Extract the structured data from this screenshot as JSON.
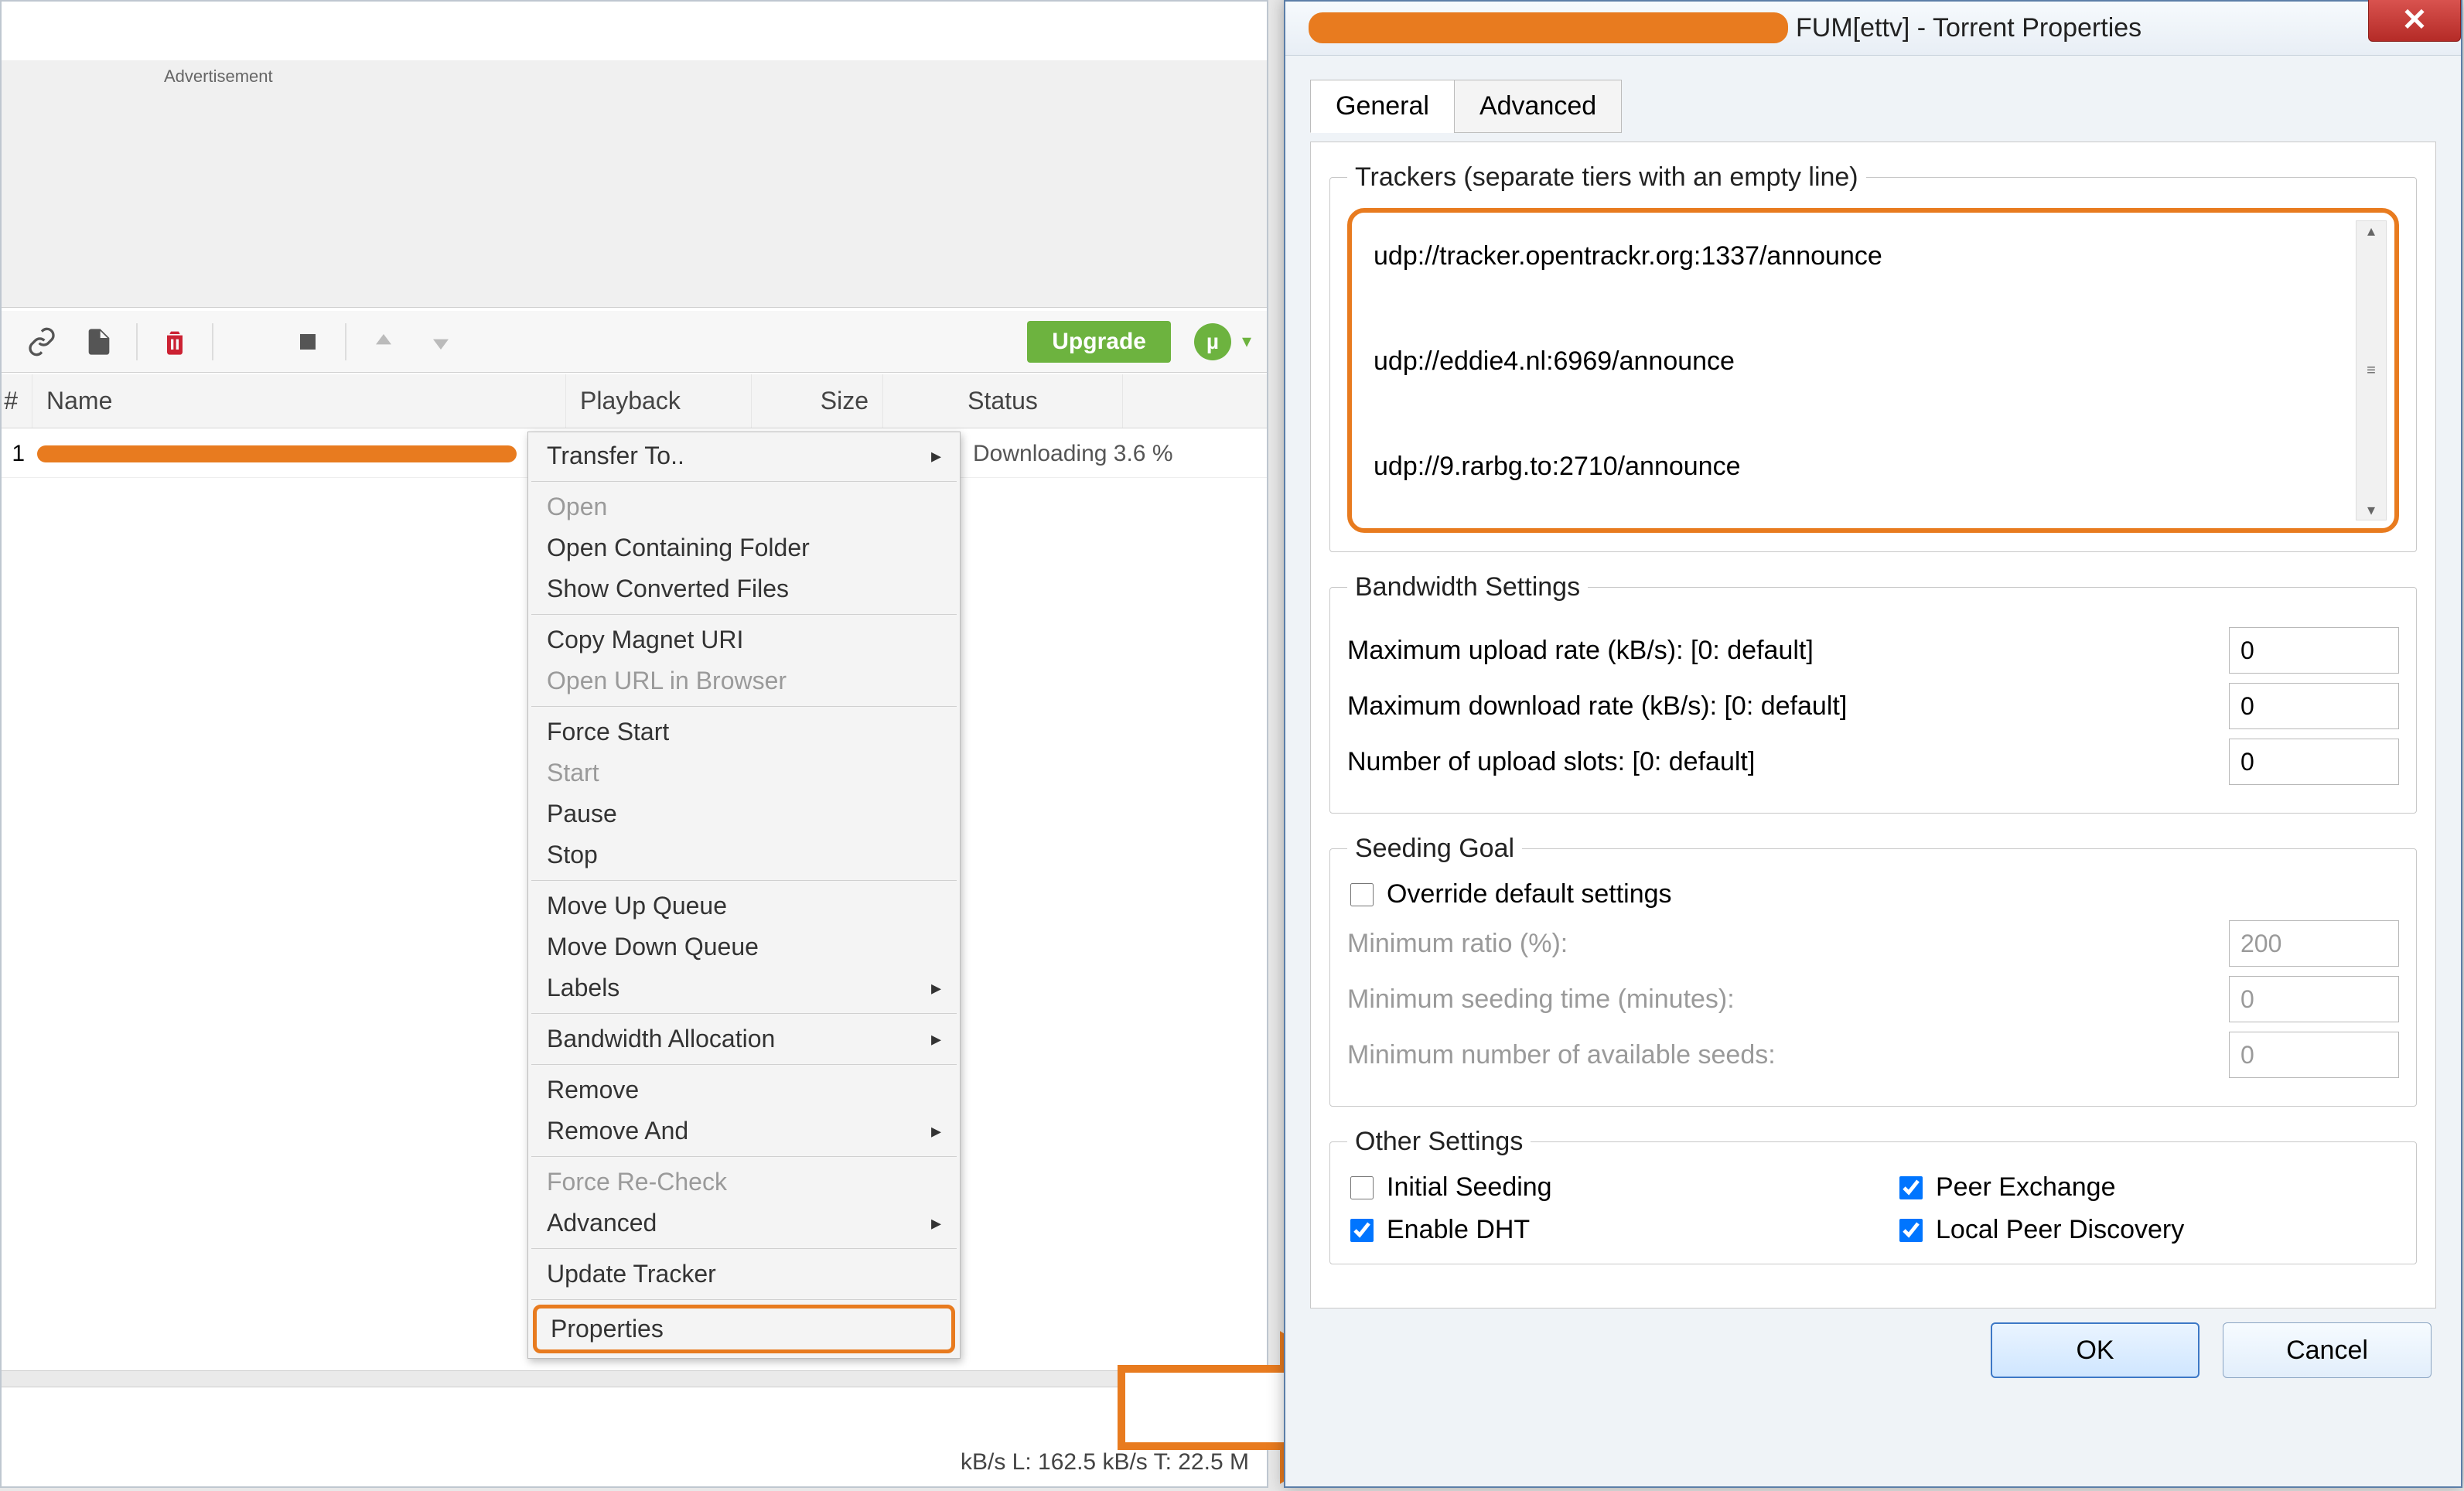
{
  "main": {
    "ad_label": "Advertisement",
    "upgrade": "Upgrade",
    "columns": {
      "num": "#",
      "name": "Name",
      "playback": "Playback",
      "size": "Size",
      "status": "Status"
    },
    "row1": {
      "num": "1",
      "status": "Downloading 3.6 %"
    },
    "statusbar_fragment": "kB/s L: 162.5 kB/s T: 22.5 M"
  },
  "context_menu": {
    "transfer_to": "Transfer To..",
    "open": "Open",
    "open_containing": "Open Containing Folder",
    "show_converted": "Show Converted Files",
    "copy_magnet": "Copy Magnet URI",
    "open_url": "Open URL in Browser",
    "force_start": "Force Start",
    "start": "Start",
    "pause": "Pause",
    "stop": "Stop",
    "move_up": "Move Up Queue",
    "move_down": "Move Down Queue",
    "labels": "Labels",
    "bandwidth_alloc": "Bandwidth Allocation",
    "remove": "Remove",
    "remove_and": "Remove And",
    "force_recheck": "Force Re-Check",
    "advanced": "Advanced",
    "update_tracker": "Update Tracker",
    "properties": "Properties"
  },
  "dialog": {
    "title_fragment": "FUM[ettv] - Torrent Properties",
    "tabs": {
      "general": "General",
      "advanced": "Advanced"
    },
    "trackers": {
      "legend": "Trackers (separate tiers with an empty line)",
      "text": "udp://tracker.opentrackr.org:1337/announce\n\nudp://eddie4.nl:6969/announce\n\nudp://9.rarbg.to:2710/announce"
    },
    "bandwidth": {
      "legend": "Bandwidth Settings",
      "max_up_label": "Maximum upload rate (kB/s): [0: default]",
      "max_up": "0",
      "max_down_label": "Maximum download rate (kB/s): [0: default]",
      "max_down": "0",
      "slots_label": "Number of upload slots: [0: default]",
      "slots": "0"
    },
    "seeding": {
      "legend": "Seeding Goal",
      "override": "Override default settings",
      "min_ratio_label": "Minimum ratio (%):",
      "min_ratio": "200",
      "min_time_label": "Minimum seeding time (minutes):",
      "min_time": "0",
      "min_seeds_label": "Minimum number of available seeds:",
      "min_seeds": "0"
    },
    "other": {
      "legend": "Other Settings",
      "initial_seeding": "Initial Seeding",
      "peer_exchange": "Peer Exchange",
      "enable_dht": "Enable DHT",
      "local_peer": "Local Peer Discovery"
    },
    "buttons": {
      "ok": "OK",
      "cancel": "Cancel"
    }
  }
}
